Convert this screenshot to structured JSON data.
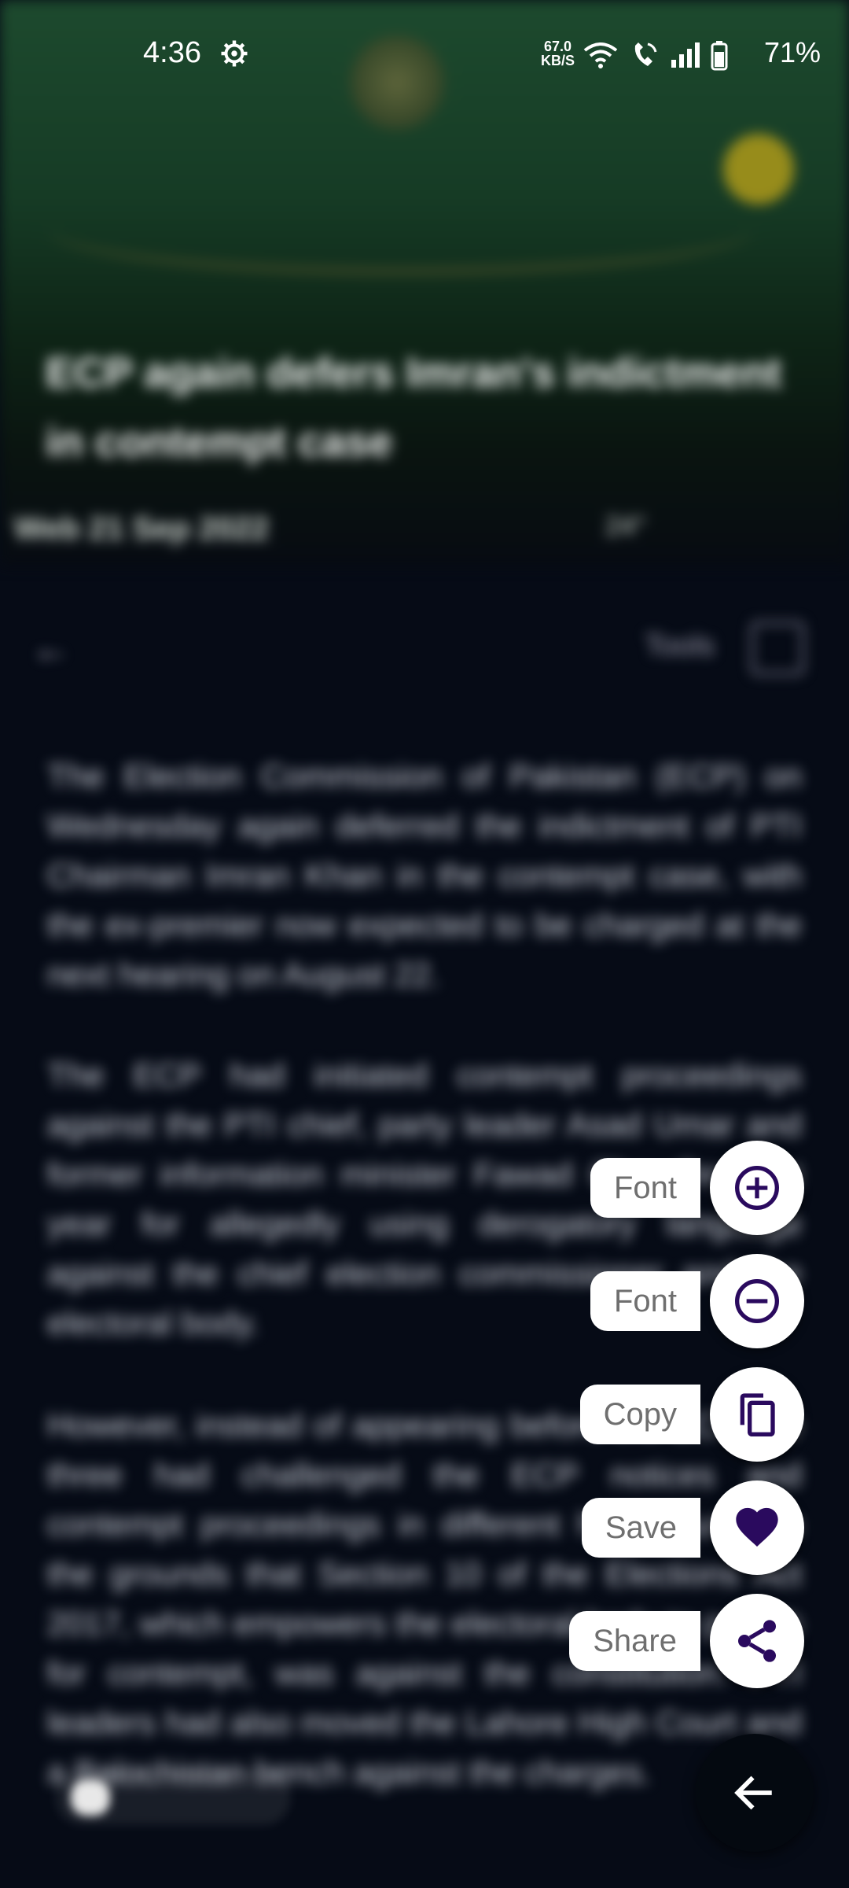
{
  "status_bar": {
    "time": "4:36",
    "speed_value": "67.0",
    "speed_unit": "KB/S",
    "battery": "71%"
  },
  "article": {
    "title": "ECP again defers Imran's indictment in contempt case",
    "meta_left": "Web 21 Sep 2022",
    "meta_right": "24°",
    "toolbar_right": "Tools",
    "paragraphs": [
      "The Election Commission of Pakistan (ECP) on Wednesday again deferred the indictment of PTI Chairman Imran Khan in the contempt case, with the ex-premier now expected to be charged at the next hearing on August 22.",
      "The ECP had initiated contempt proceedings against the PTI chief, party leader Asad Umar and former information minister Fawad Chaudhry last year for allegedly using derogatory language against the chief election commissioner and the electoral body.",
      "However, instead of appearing before the ECP, the three had challenged the ECP notices and contempt proceedings in different high courts on the grounds that Section 10 of the Elections Act 2017, which empowers the electoral body to punish for contempt, was against the constitution. PTI leaders had also moved the Lahore High Court and a Balochistan bench against the charges."
    ],
    "highlight_word": "contempt"
  },
  "fab_menu": {
    "items": [
      {
        "label": "Font",
        "icon": "plus-circle-icon"
      },
      {
        "label": "Font",
        "icon": "minus-circle-icon"
      },
      {
        "label": "Copy",
        "icon": "copy-icon"
      },
      {
        "label": "Save",
        "icon": "heart-icon"
      },
      {
        "label": "Share",
        "icon": "share-icon"
      }
    ],
    "close_icon": "arrow-left-icon"
  },
  "colors": {
    "accent": "#2a0a5e",
    "fab_background": "#ffffff",
    "label_text": "#6f6f6f",
    "scrim": "#060b16"
  }
}
